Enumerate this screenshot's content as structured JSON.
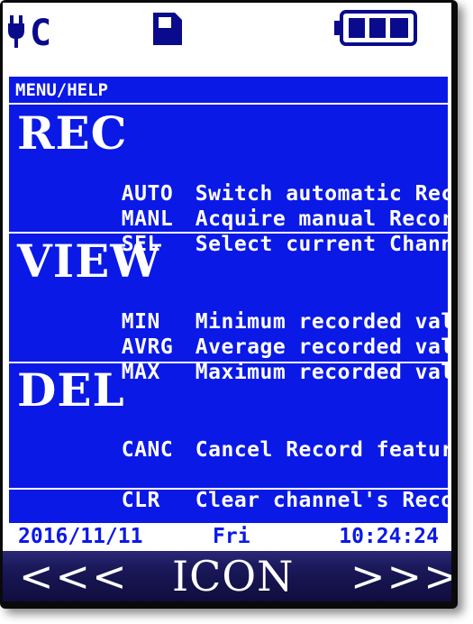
{
  "status_bar": {
    "power_label": "C",
    "icons": [
      "power-plug-icon",
      "sd-card-icon",
      "battery-icon"
    ],
    "battery_level": 1.0
  },
  "menu": {
    "title": "MENU/HELP",
    "sections": [
      {
        "title": "REC",
        "items": [
          {
            "code": "AUTO",
            "desc": "Switch automatic Record"
          },
          {
            "code": "MANL",
            "desc": "Acquire manual Record"
          },
          {
            "code": "SEL",
            "desc": "Select current Channel"
          }
        ]
      },
      {
        "title": "VIEW",
        "items": [
          {
            "code": "MIN",
            "desc": "Minimum recorded value"
          },
          {
            "code": "AVRG",
            "desc": "Average recorded value"
          },
          {
            "code": "MAX",
            "desc": "Maximum recorded value"
          }
        ]
      },
      {
        "title": "DEL",
        "items": [
          {
            "code": "CANC",
            "desc": "Cancel Record feature"
          },
          {
            "code": "CLR",
            "desc": "Clear channel's Record"
          }
        ]
      }
    ]
  },
  "datetime": {
    "date": "2016/11/11",
    "day": "Fri",
    "time": "10:24:24"
  },
  "nav": {
    "left": "<<<",
    "center": "ICON",
    "right": ">>>"
  },
  "colors": {
    "panel_blue": "#0a19e6",
    "status_icons": "#0a0a8c",
    "nav_bar": "#1a1858"
  }
}
